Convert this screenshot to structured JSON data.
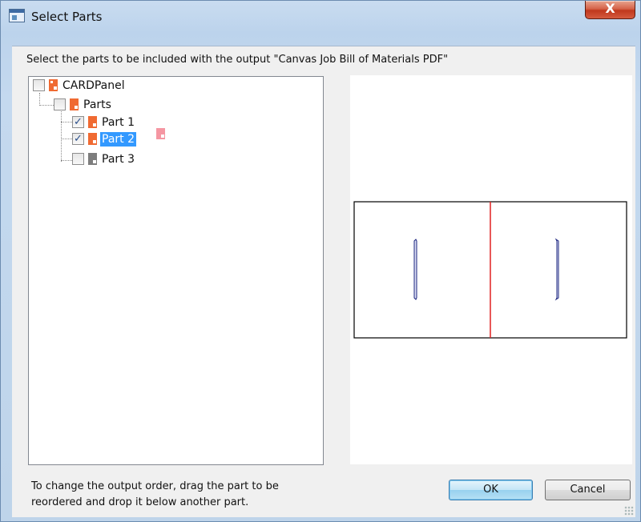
{
  "window": {
    "title": "Select Parts",
    "close_glyph": "X"
  },
  "instruction": "Select the parts to be included with the output \"Canvas Job Bill of Materials PDF\"",
  "tree": {
    "root": {
      "label": "CARDPanel",
      "checked": false,
      "icon": "assembly-icon"
    },
    "group": {
      "label": "Parts",
      "checked": false,
      "icon": "part-icon"
    },
    "items": [
      {
        "label": "Part 1",
        "checked": true,
        "selected": false,
        "icon": "part-icon"
      },
      {
        "label": "Part 2",
        "checked": true,
        "selected": true,
        "icon": "part-icon"
      },
      {
        "label": "Part 3",
        "checked": false,
        "selected": false,
        "icon": "part-gray-icon"
      }
    ]
  },
  "check_glyph": "✓",
  "help_text": {
    "line1": "To change the output order, drag the part to be",
    "line2": "reordered and drop it below another part."
  },
  "buttons": {
    "ok_label": "OK",
    "cancel_label": "Cancel"
  },
  "colors": {
    "accent_selected": "#3399ff",
    "part_icon": "#f06a32",
    "part_icon_gray": "#7d7d7d",
    "preview_divider": "#e02020",
    "preview_slot": "#1a237e",
    "close_button": "#c7452a"
  }
}
